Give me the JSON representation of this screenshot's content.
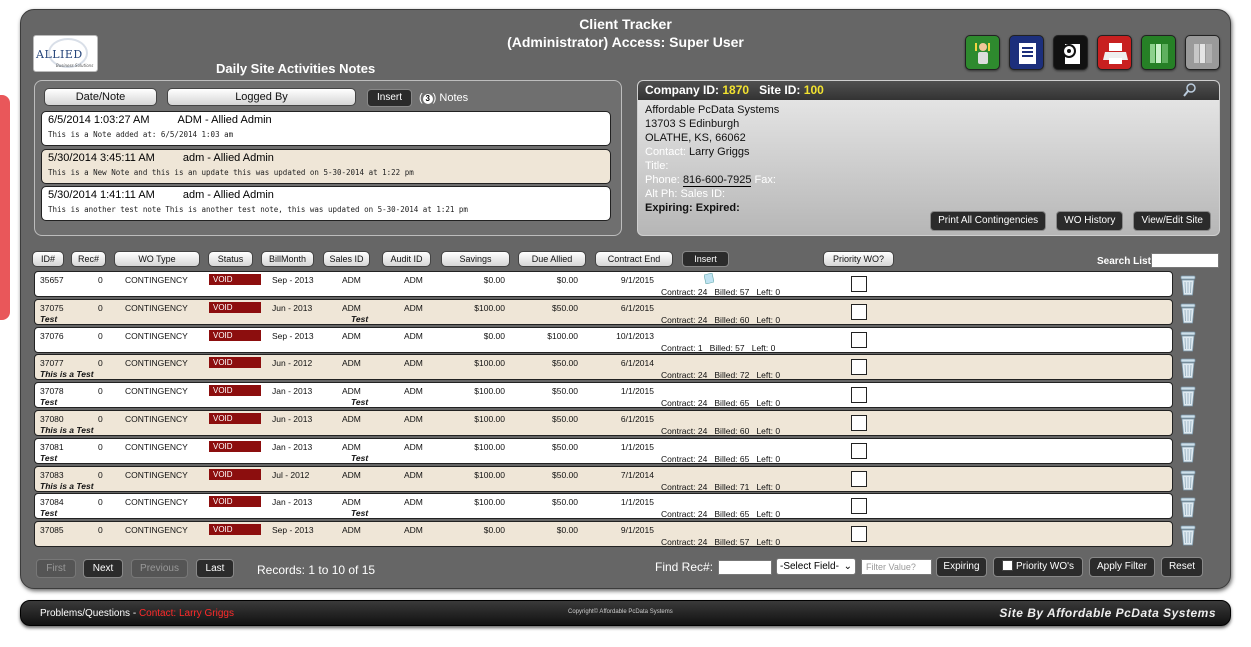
{
  "app": {
    "title": "Client Tracker",
    "access": "(Administrator) Access: Super User",
    "logo_text": "ALLIED",
    "logo_subtext": "Business Solutions",
    "notes_heading": "Daily Site Activities Notes"
  },
  "top_icons": [
    {
      "name": "users-icon",
      "bg": "#2e8a2e"
    },
    {
      "name": "document-icon",
      "bg": "#1c2f7c"
    },
    {
      "name": "settings-document-icon",
      "bg": "#111111"
    },
    {
      "name": "printer-icon",
      "bg": "#c82020"
    },
    {
      "name": "books-icon",
      "bg": "#268026"
    },
    {
      "name": "books-gray-icon",
      "bg": "#9a9a9a"
    }
  ],
  "notes": {
    "date_btn": "Date/Note",
    "logged_btn": "Logged By",
    "insert_btn": "Insert",
    "count": "3",
    "count_label": "Notes",
    "items": [
      {
        "date": "6/5/2014 1:03:27 AM",
        "user": "ADM - Allied Admin",
        "text": "This is a Note added at: 6/5/2014 1:03 am"
      },
      {
        "date": "5/30/2014 3:45:11 AM",
        "user": "adm - Allied Admin",
        "text": "This is a New Note and this is an update this was updated on 5-30-2014 at 1:22 pm"
      },
      {
        "date": "5/30/2014 1:41:11 AM",
        "user": "adm - Allied Admin",
        "text": "This is another test note This is another test note, this was updated on 5-30-2014 at 1:21 pm"
      }
    ]
  },
  "company": {
    "company_id_label": "Company ID:",
    "company_id": "1870",
    "site_id_label": "Site ID:",
    "site_id": "100",
    "name": "Affordable PcData Systems",
    "address1": "13703 S Edinburgh",
    "address2": "OLATHE, KS, 66062",
    "contact_label": "Contact:",
    "contact": "Larry Griggs",
    "title_label": "Title:",
    "phone_label": "Phone:",
    "phone": "816-600-7925",
    "fax_label": "Fax:",
    "alt_label": "Alt Ph:",
    "sales_label": "Sales ID:",
    "expiring_label": "Expiring:",
    "expired_label": "Expired:",
    "print_btn": "Print All Contingencies",
    "history_btn": "WO History",
    "edit_btn": "View/Edit Site"
  },
  "columns": {
    "id": "ID#",
    "rec": "Rec#",
    "type": "WO Type",
    "status": "Status",
    "billmonth": "BillMonth",
    "sales": "Sales ID",
    "audit": "Audit ID",
    "savings": "Savings",
    "due": "Due Allied",
    "contract_end": "Contract End",
    "insert": "Insert",
    "priority": "Priority WO?",
    "search_label": "Search List"
  },
  "rows": [
    {
      "id": "35657",
      "rec": "0",
      "type": "CONTINGENCY",
      "status": "VOID",
      "billmonth": "Sep - 2013",
      "sales": "ADM",
      "audit": "ADM",
      "savings": "$0.00",
      "due": "$0.00",
      "end": "9/1/2015",
      "sub": "",
      "sub2": "",
      "totals": "Contract: 24   Billed: 57   Left: 0"
    },
    {
      "id": "37075",
      "rec": "0",
      "type": "CONTINGENCY",
      "status": "VOID",
      "billmonth": "Jun - 2013",
      "sales": "ADM",
      "audit": "ADM",
      "savings": "$100.00",
      "due": "$50.00",
      "end": "6/1/2015",
      "sub": "Test",
      "sub2": "Test",
      "totals": "Contract: 24   Billed: 60   Left: 0"
    },
    {
      "id": "37076",
      "rec": "0",
      "type": "CONTINGENCY",
      "status": "VOID",
      "billmonth": "Sep - 2013",
      "sales": "ADM",
      "audit": "ADM",
      "savings": "$0.00",
      "due": "$100.00",
      "end": "10/1/2013",
      "sub": "",
      "sub2": "",
      "totals": "Contract: 1   Billed: 57   Left: 0"
    },
    {
      "id": "37077",
      "rec": "0",
      "type": "CONTINGENCY",
      "status": "VOID",
      "billmonth": "Jun - 2012",
      "sales": "ADM",
      "audit": "ADM",
      "savings": "$100.00",
      "due": "$50.00",
      "end": "6/1/2014",
      "sub": "This is a Test",
      "sub2": "",
      "totals": "Contract: 24   Billed: 72   Left: 0"
    },
    {
      "id": "37078",
      "rec": "0",
      "type": "CONTINGENCY",
      "status": "VOID",
      "billmonth": "Jan - 2013",
      "sales": "ADM",
      "audit": "ADM",
      "savings": "$100.00",
      "due": "$50.00",
      "end": "1/1/2015",
      "sub": "Test",
      "sub2": "Test",
      "totals": "Contract: 24   Billed: 65   Left: 0"
    },
    {
      "id": "37080",
      "rec": "0",
      "type": "CONTINGENCY",
      "status": "VOID",
      "billmonth": "Jun - 2013",
      "sales": "ADM",
      "audit": "ADM",
      "savings": "$100.00",
      "due": "$50.00",
      "end": "6/1/2015",
      "sub": "This is a Test",
      "sub2": "",
      "totals": "Contract: 24   Billed: 60   Left: 0"
    },
    {
      "id": "37081",
      "rec": "0",
      "type": "CONTINGENCY",
      "status": "VOID",
      "billmonth": "Jan - 2013",
      "sales": "ADM",
      "audit": "ADM",
      "savings": "$100.00",
      "due": "$50.00",
      "end": "1/1/2015",
      "sub": "Test",
      "sub2": "Test",
      "totals": "Contract: 24   Billed: 65   Left: 0"
    },
    {
      "id": "37083",
      "rec": "0",
      "type": "CONTINGENCY",
      "status": "VOID",
      "billmonth": "Jul - 2012",
      "sales": "ADM",
      "audit": "ADM",
      "savings": "$100.00",
      "due": "$50.00",
      "end": "7/1/2014",
      "sub": "This is a Test",
      "sub2": "",
      "totals": "Contract: 24   Billed: 71   Left: 0"
    },
    {
      "id": "37084",
      "rec": "0",
      "type": "CONTINGENCY",
      "status": "VOID",
      "billmonth": "Jan - 2013",
      "sales": "ADM",
      "audit": "ADM",
      "savings": "$100.00",
      "due": "$50.00",
      "end": "1/1/2015",
      "sub": "Test",
      "sub2": "Test",
      "totals": "Contract: 24   Billed: 65   Left: 0"
    },
    {
      "id": "37085",
      "rec": "0",
      "type": "CONTINGENCY",
      "status": "VOID",
      "billmonth": "Sep - 2013",
      "sales": "ADM",
      "audit": "ADM",
      "savings": "$0.00",
      "due": "$0.00",
      "end": "9/1/2015",
      "sub": "",
      "sub2": "",
      "totals": "Contract: 24   Billed: 57   Left: 0"
    }
  ],
  "pager": {
    "first": "First",
    "next": "Next",
    "previous": "Previous",
    "last": "Last",
    "records": "Records: 1 to 10 of 15"
  },
  "filters": {
    "find_label": "Find Rec#:",
    "find_value": "",
    "select_field": "-Select Field-",
    "filter_placeholder": "Filter Value?",
    "expiring_btn": "Expiring",
    "priority_btn": "Priority WO's",
    "apply_btn": "Apply Filter",
    "reset_btn": "Reset"
  },
  "footer": {
    "problems": "Problems/Questions -",
    "contact_label": "Contact:",
    "contact_name": "Larry Griggs",
    "copyright": "Copyright© Affordable PcData Systems",
    "site_by": "Site By Affordable PcData Systems"
  }
}
